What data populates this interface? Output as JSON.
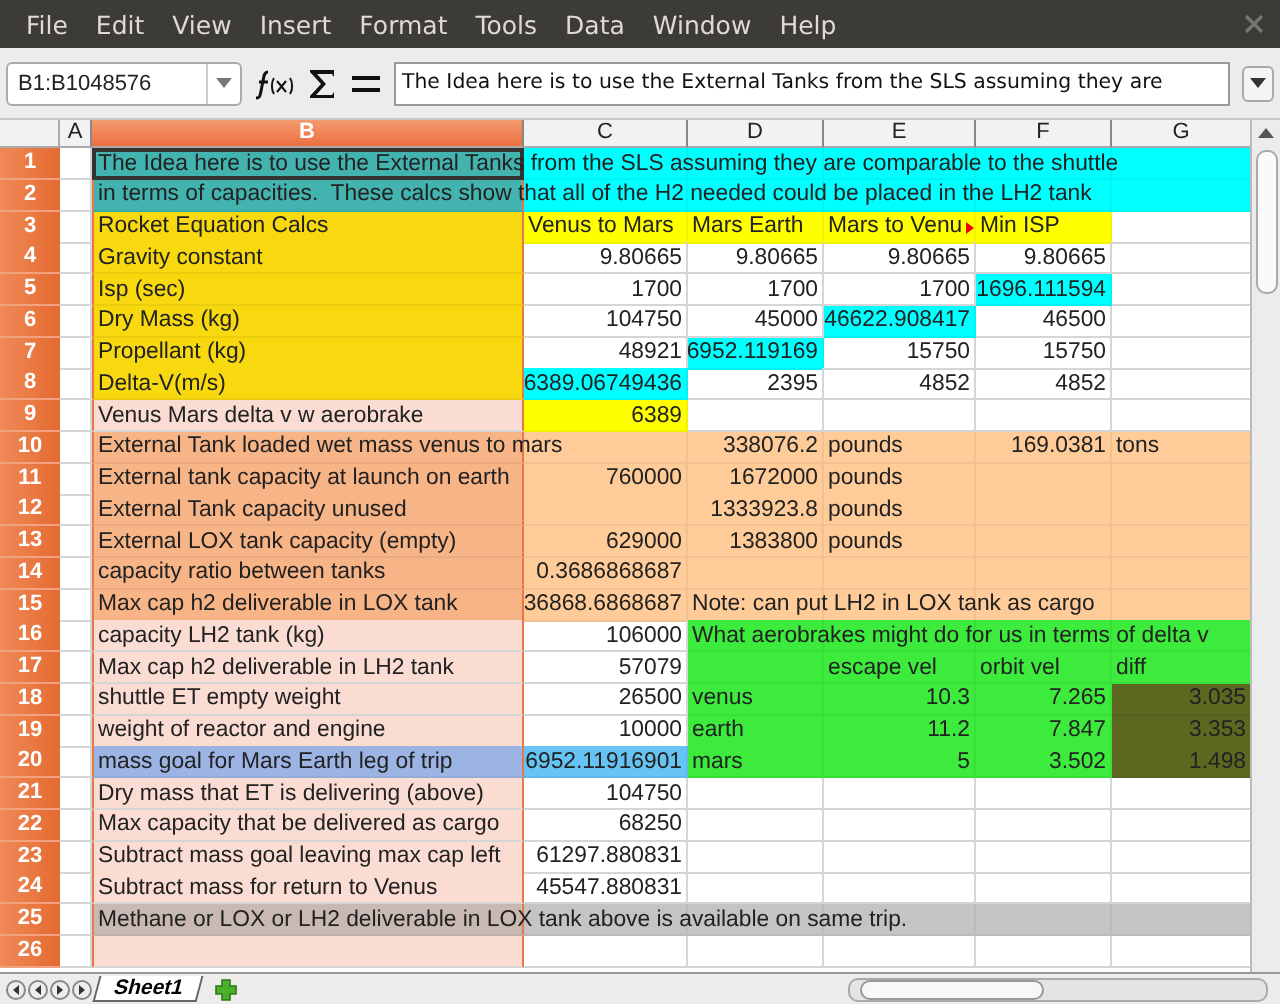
{
  "menu": [
    "File",
    "Edit",
    "View",
    "Insert",
    "Format",
    "Tools",
    "Data",
    "Window",
    "Help"
  ],
  "toolbar": {
    "name_box": "B1:B1048576",
    "formula": "The Idea here is to use the External Tanks from the SLS assuming they are"
  },
  "columns": [
    {
      "label": "A",
      "selected": false
    },
    {
      "label": "B",
      "selected": true
    },
    {
      "label": "C",
      "selected": false
    },
    {
      "label": "D",
      "selected": false
    },
    {
      "label": "E",
      "selected": false
    },
    {
      "label": "F",
      "selected": false
    },
    {
      "label": "G",
      "selected": false
    }
  ],
  "rows": [
    {
      "number": "1",
      "selected": true,
      "cells": [
        {},
        {
          "text": "The Idea here is to use the External Tanks from the SLS assuming they are comparable to the shuttle",
          "kind": "text",
          "color": "#43b3b0",
          "cursor": true
        },
        {
          "color": "#00ffff"
        },
        {
          "color": "#00ffff"
        },
        {
          "color": "#00ffff"
        },
        {
          "color": "#00ffff"
        },
        {
          "color": "#00ffff"
        }
      ]
    },
    {
      "number": "2",
      "selected": true,
      "cells": [
        {},
        {
          "text": "in terms of capacities.  These calcs show that all of the H2 needed could be placed in the LH2 tank",
          "kind": "text",
          "color": "#43b3b0"
        },
        {
          "color": "#00ffff"
        },
        {
          "color": "#00ffff"
        },
        {
          "color": "#00ffff"
        },
        {
          "color": "#00ffff"
        },
        {
          "color": "#00ffff"
        }
      ]
    },
    {
      "number": "3",
      "selected": true,
      "cells": [
        {},
        {
          "text": "Rocket Equation Calcs",
          "kind": "text",
          "color": "#f8d90f"
        },
        {
          "text": "Venus to Mars",
          "kind": "text",
          "color": "#ffff00"
        },
        {
          "text": "Mars Earth",
          "kind": "text",
          "color": "#ffff00"
        },
        {
          "text": "Mars to Venu",
          "kind": "text",
          "color": "#ffff00",
          "clipped": true
        },
        {
          "text": "Min ISP",
          "kind": "text",
          "color": "#ffff00"
        },
        {}
      ]
    },
    {
      "number": "4",
      "selected": true,
      "cells": [
        {},
        {
          "text": "Gravity constant",
          "kind": "text",
          "color": "#f8d90f"
        },
        {
          "text": "9.80665",
          "kind": "number"
        },
        {
          "text": "9.80665",
          "kind": "number"
        },
        {
          "text": "9.80665",
          "kind": "number"
        },
        {
          "text": "9.80665",
          "kind": "number"
        },
        {}
      ]
    },
    {
      "number": "5",
      "selected": true,
      "cells": [
        {},
        {
          "text": "Isp (sec)",
          "kind": "text",
          "color": "#f8d90f"
        },
        {
          "text": "1700",
          "kind": "number"
        },
        {
          "text": "1700",
          "kind": "number"
        },
        {
          "text": "1700",
          "kind": "number"
        },
        {
          "text": "1696.111594",
          "kind": "number",
          "color": "#00ffff"
        },
        {}
      ]
    },
    {
      "number": "6",
      "selected": true,
      "cells": [
        {},
        {
          "text": "Dry Mass (kg)",
          "kind": "text",
          "color": "#f8d90f"
        },
        {
          "text": "104750",
          "kind": "number"
        },
        {
          "text": "45000",
          "kind": "number"
        },
        {
          "text": "46622.908417",
          "kind": "number",
          "color": "#00ffff"
        },
        {
          "text": "46500",
          "kind": "number"
        },
        {}
      ]
    },
    {
      "number": "7",
      "selected": true,
      "cells": [
        {},
        {
          "text": "Propellant (kg)",
          "kind": "text",
          "color": "#f8d90f"
        },
        {
          "text": "48921",
          "kind": "number"
        },
        {
          "text": "6952.119169",
          "kind": "number",
          "color": "#00ffff"
        },
        {
          "text": "15750",
          "kind": "number"
        },
        {
          "text": "15750",
          "kind": "number"
        },
        {}
      ]
    },
    {
      "number": "8",
      "selected": true,
      "cells": [
        {},
        {
          "text": "Delta-V(m/s)",
          "kind": "text",
          "color": "#f8d90f"
        },
        {
          "text": "6389.06749436",
          "kind": "number",
          "color": "#00ffff"
        },
        {
          "text": "2395",
          "kind": "number"
        },
        {
          "text": "4852",
          "kind": "number"
        },
        {
          "text": "4852",
          "kind": "number"
        },
        {}
      ]
    },
    {
      "number": "9",
      "selected": true,
      "cells": [
        {},
        {
          "text": "Venus Mars delta v w aerobrake",
          "kind": "text"
        },
        {
          "text": "6389",
          "kind": "number",
          "color": "#ffff00"
        },
        {},
        {},
        {},
        {}
      ]
    },
    {
      "number": "10",
      "selected": true,
      "cells": [
        {},
        {
          "text": "External Tank loaded wet mass venus to mars",
          "kind": "text",
          "color": "#f7b487"
        },
        {
          "color": "#ffcc99"
        },
        {
          "text": "338076.2",
          "kind": "number",
          "color": "#ffcc99"
        },
        {
          "text": "pounds",
          "kind": "text",
          "color": "#ffcc99"
        },
        {
          "text": "169.0381",
          "kind": "number",
          "color": "#ffcc99"
        },
        {
          "text": "tons",
          "kind": "text",
          "color": "#ffcc99"
        }
      ]
    },
    {
      "number": "11",
      "selected": true,
      "cells": [
        {},
        {
          "text": "External tank capacity at launch on earth",
          "kind": "text",
          "color": "#f7b487"
        },
        {
          "text": "760000",
          "kind": "number",
          "color": "#ffcc99"
        },
        {
          "text": "1672000",
          "kind": "number",
          "color": "#ffcc99"
        },
        {
          "text": "pounds",
          "kind": "text",
          "color": "#ffcc99"
        },
        {
          "color": "#ffcc99"
        },
        {
          "color": "#ffcc99"
        }
      ]
    },
    {
      "number": "12",
      "selected": true,
      "cells": [
        {},
        {
          "text": "External Tank capacity unused",
          "kind": "text",
          "color": "#f7b487"
        },
        {
          "color": "#ffcc99"
        },
        {
          "text": "1333923.8",
          "kind": "number",
          "color": "#ffcc99"
        },
        {
          "text": "pounds",
          "kind": "text",
          "color": "#ffcc99"
        },
        {
          "color": "#ffcc99"
        },
        {
          "color": "#ffcc99"
        }
      ]
    },
    {
      "number": "13",
      "selected": true,
      "cells": [
        {},
        {
          "text": "External LOX tank capacity (empty)",
          "kind": "text",
          "color": "#f7b487"
        },
        {
          "text": "629000",
          "kind": "number",
          "color": "#ffcc99"
        },
        {
          "text": "1383800",
          "kind": "number",
          "color": "#ffcc99"
        },
        {
          "text": "pounds",
          "kind": "text",
          "color": "#ffcc99"
        },
        {
          "color": "#ffcc99"
        },
        {
          "color": "#ffcc99"
        }
      ]
    },
    {
      "number": "14",
      "selected": true,
      "cells": [
        {},
        {
          "text": "capacity ratio between tanks",
          "kind": "text",
          "color": "#f7b487"
        },
        {
          "text": "0.3686868687",
          "kind": "number",
          "color": "#ffcc99"
        },
        {
          "color": "#ffcc99"
        },
        {
          "color": "#ffcc99"
        },
        {
          "color": "#ffcc99"
        },
        {
          "color": "#ffcc99"
        }
      ]
    },
    {
      "number": "15",
      "selected": true,
      "cells": [
        {},
        {
          "text": "Max cap h2 deliverable in LOX tank",
          "kind": "text",
          "color": "#f7b487"
        },
        {
          "text": "36868.6868687",
          "kind": "number",
          "color": "#ffcc99"
        },
        {
          "text": "Note: can put LH2 in LOX tank as cargo",
          "kind": "text",
          "color": "#ffcc99"
        },
        {
          "color": "#ffcc99"
        },
        {
          "color": "#ffcc99"
        },
        {
          "color": "#ffcc99"
        }
      ]
    },
    {
      "number": "16",
      "selected": true,
      "cells": [
        {},
        {
          "text": "capacity LH2 tank (kg)",
          "kind": "text"
        },
        {
          "text": "106000",
          "kind": "number"
        },
        {
          "text": "What aerobrakes might do for us in terms of delta v",
          "kind": "text",
          "color": "#3deb3d"
        },
        {
          "color": "#3deb3d"
        },
        {
          "color": "#3deb3d"
        },
        {
          "color": "#3deb3d"
        }
      ]
    },
    {
      "number": "17",
      "selected": true,
      "cells": [
        {},
        {
          "text": "Max cap h2 deliverable in LH2 tank",
          "kind": "text"
        },
        {
          "text": "57079",
          "kind": "number"
        },
        {
          "color": "#3deb3d"
        },
        {
          "text": "escape vel",
          "kind": "text",
          "color": "#3deb3d"
        },
        {
          "text": "orbit vel",
          "kind": "text",
          "color": "#3deb3d"
        },
        {
          "text": "diff",
          "kind": "text",
          "color": "#3deb3d"
        }
      ]
    },
    {
      "number": "18",
      "selected": true,
      "cells": [
        {},
        {
          "text": "shuttle ET empty weight",
          "kind": "text"
        },
        {
          "text": "26500",
          "kind": "number"
        },
        {
          "text": "venus",
          "kind": "text",
          "color": "#3deb3d"
        },
        {
          "text": "10.3",
          "kind": "number",
          "color": "#3deb3d"
        },
        {
          "text": "7.265",
          "kind": "number",
          "color": "#3deb3d"
        },
        {
          "text": "3.035",
          "kind": "number",
          "color": "#5c6820"
        }
      ]
    },
    {
      "number": "19",
      "selected": true,
      "cells": [
        {},
        {
          "text": "weight of reactor and engine",
          "kind": "text"
        },
        {
          "text": "10000",
          "kind": "number"
        },
        {
          "text": "earth",
          "kind": "text",
          "color": "#3deb3d"
        },
        {
          "text": "11.2",
          "kind": "number",
          "color": "#3deb3d"
        },
        {
          "text": "7.847",
          "kind": "number",
          "color": "#3deb3d"
        },
        {
          "text": "3.353",
          "kind": "number",
          "color": "#5c6820"
        }
      ]
    },
    {
      "number": "20",
      "selected": true,
      "cells": [
        {},
        {
          "text": "mass goal for Mars Earth leg of trip",
          "kind": "text",
          "color": "#9cb4e4"
        },
        {
          "text": "6952.11916901",
          "kind": "number",
          "color": "#66c4f4"
        },
        {
          "text": "mars",
          "kind": "text",
          "color": "#3deb3d"
        },
        {
          "text": "5",
          "kind": "number",
          "color": "#3deb3d"
        },
        {
          "text": "3.502",
          "kind": "number",
          "color": "#3deb3d"
        },
        {
          "text": "1.498",
          "kind": "number",
          "color": "#5c6820"
        }
      ]
    },
    {
      "number": "21",
      "selected": true,
      "cells": [
        {},
        {
          "text": "Dry mass that ET is delivering (above)",
          "kind": "text"
        },
        {
          "text": "104750",
          "kind": "number"
        },
        {},
        {},
        {},
        {}
      ]
    },
    {
      "number": "22",
      "selected": true,
      "cells": [
        {},
        {
          "text": "Max capacity that be delivered as cargo",
          "kind": "text"
        },
        {
          "text": "68250",
          "kind": "number"
        },
        {},
        {},
        {},
        {}
      ]
    },
    {
      "number": "23",
      "selected": true,
      "cells": [
        {},
        {
          "text": "Subtract mass goal leaving max cap left",
          "kind": "text"
        },
        {
          "text": "61297.880831",
          "kind": "number"
        },
        {},
        {},
        {},
        {}
      ]
    },
    {
      "number": "24",
      "selected": true,
      "cells": [
        {},
        {
          "text": "Subtract mass for return to Venus",
          "kind": "text"
        },
        {
          "text": "45547.880831",
          "kind": "number"
        },
        {},
        {},
        {},
        {}
      ]
    },
    {
      "number": "25",
      "selected": true,
      "cells": [
        {},
        {
          "text": "Methane or LOX or LH2 deliverable in LOX tank above is available on same trip.",
          "kind": "text",
          "color": "#c9b9b3"
        },
        {
          "color": "#c4c4c4"
        },
        {
          "color": "#c4c4c4"
        },
        {
          "color": "#c4c4c4"
        },
        {
          "color": "#c4c4c4"
        },
        {
          "color": "#c4c4c4"
        }
      ]
    },
    {
      "number": "26",
      "selected": true,
      "cells": [
        {},
        {},
        {},
        {},
        {},
        {},
        {}
      ]
    }
  ],
  "sheet_tabs": [
    {
      "label": "Sheet1",
      "selected": true
    }
  ]
}
